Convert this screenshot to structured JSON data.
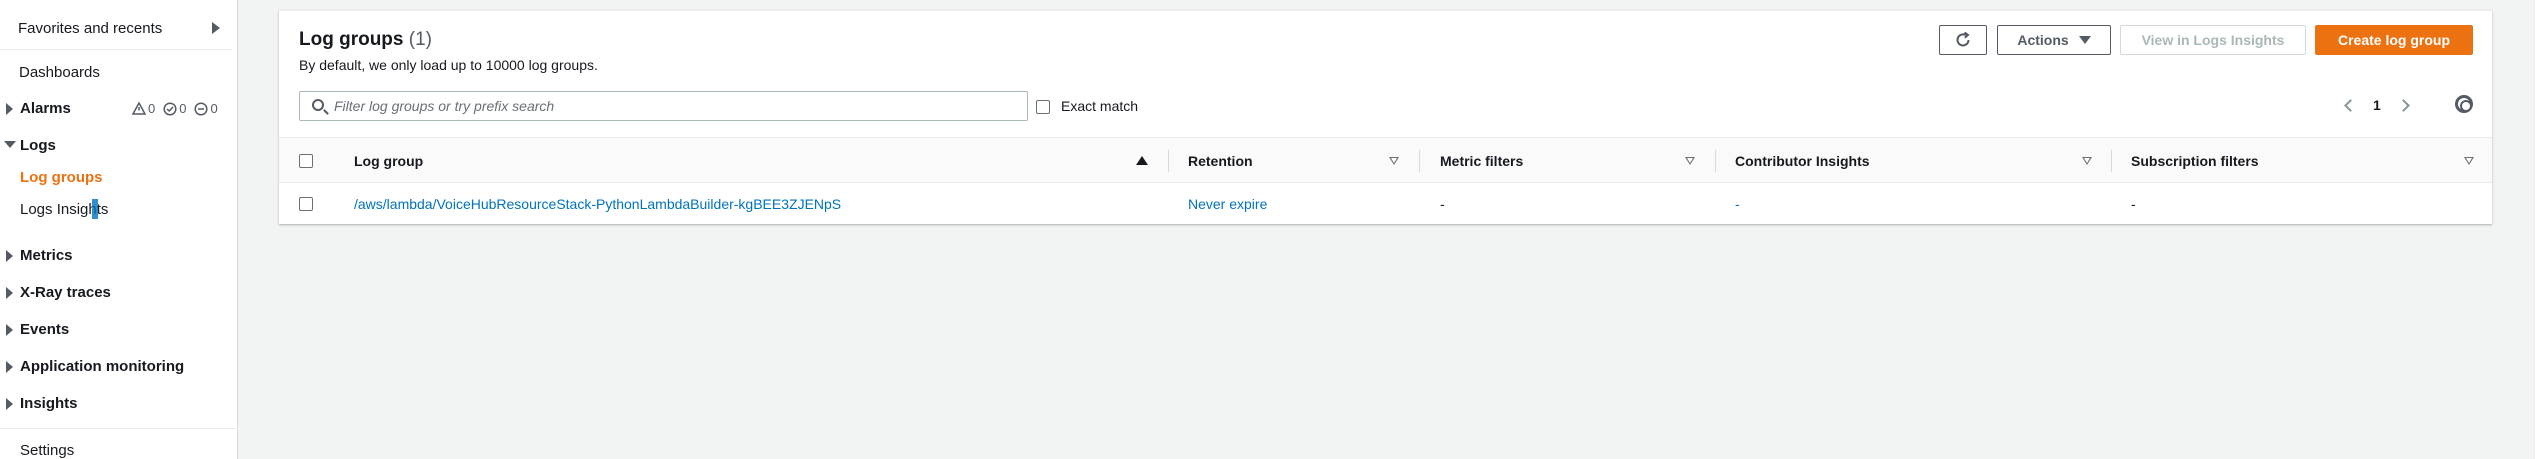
{
  "sidebar": {
    "favorites": "Favorites and recents",
    "dashboards": "Dashboards",
    "alarms": "Alarms",
    "alarm_counts": {
      "in_alarm": "0",
      "ok": "0",
      "insufficient": "0"
    },
    "logs": "Logs",
    "log_groups": "Log groups",
    "logs_insights": "Logs Insights",
    "metrics": "Metrics",
    "xray": "X-Ray traces",
    "events": "Events",
    "app_monitoring": "Application monitoring",
    "insights": "Insights",
    "settings": "Settings"
  },
  "panel": {
    "title": "Log groups",
    "count": "(1)",
    "subtitle": "By default, we only load up to 10000 log groups.",
    "actions_label": "Actions",
    "view_insights_label": "View in Logs Insights",
    "create_label": "Create log group",
    "search_placeholder": "Filter log groups or try prefix search",
    "exact_match": "Exact match",
    "page": "1"
  },
  "table": {
    "columns": [
      "Log group",
      "Retention",
      "Metric filters",
      "Contributor Insights",
      "Subscription filters"
    ],
    "rows": [
      {
        "log_group": "/aws/lambda/VoiceHubResourceStack-PythonLambdaBuilder-kgBEE3ZJENpS",
        "retention": "Never expire",
        "metric_filters": "-",
        "contributor_insights": "-",
        "subscription_filters": "-"
      }
    ]
  },
  "colors": {
    "accent": "#ec7211",
    "link": "#0073bb",
    "text": "#16191f",
    "border": "#d5dbdb",
    "background": "#f2f3f3"
  },
  "icons": {
    "refresh": "refresh-icon",
    "search": "search-icon",
    "settings": "gear-icon",
    "caret": "caret-icon"
  }
}
